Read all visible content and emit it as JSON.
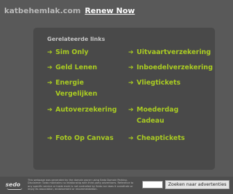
{
  "header": {
    "domain": "katbehemlak.com",
    "renew_label": "Renew Now"
  },
  "panel": {
    "title": "Gerelateerde links",
    "arrow_glyph": "➔",
    "links": [
      {
        "line1": "Sim Only",
        "line2": ""
      },
      {
        "line1": "Uitvaartverzekering",
        "line2": ""
      },
      {
        "line1": "Geld Lenen",
        "line2": ""
      },
      {
        "line1": "Inboedelverzekering",
        "line2": ""
      },
      {
        "line1": "Energie",
        "line2": "Vergelijken"
      },
      {
        "line1": "Vliegtickets",
        "line2": ""
      },
      {
        "line1": "Autoverzekering",
        "line2": ""
      },
      {
        "line1": "Moederdag",
        "line2": "Cadeau"
      },
      {
        "line1": "Foto Op Canvas",
        "line2": ""
      },
      {
        "line1": "Cheaptickets",
        "line2": ""
      }
    ]
  },
  "footer": {
    "sedo_logo_text": "sedo",
    "disclaimer": "This webpage was generated by the domain owner using Sedo Domain Parking. Disclaimer: Sedo maintains no relationship with third party advertisers. Reference to any specific service or trade mark is not controlled by Sedo nor does it constitute or imply its association, endorsement or recommendation.",
    "search_value": "",
    "search_button_label": "Zoeken naar advertenties"
  },
  "colors": {
    "background": "#595959",
    "panel": "#494949",
    "link": "#aacc22",
    "domain": "#b9b9b9"
  }
}
